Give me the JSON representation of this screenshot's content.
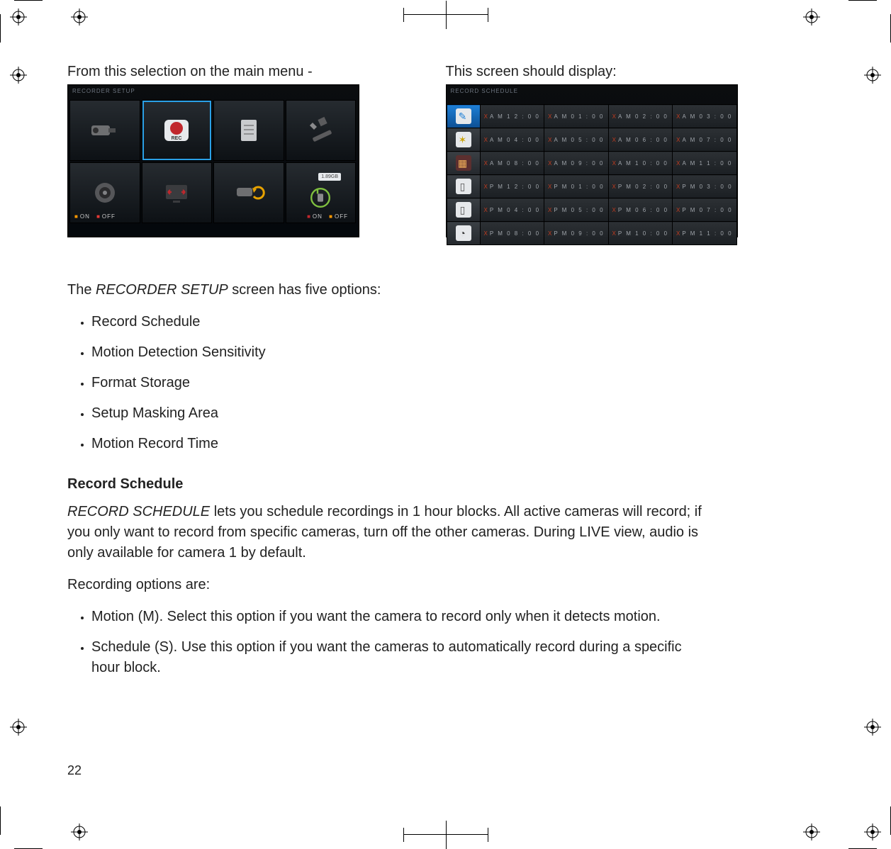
{
  "page_number": "22",
  "figures": {
    "left": {
      "caption": "From this selection on the main menu -",
      "screen_title": "RECORDER SETUP",
      "on_label": "ON",
      "off_label": "OFF",
      "sd_label": "1.89GB"
    },
    "right": {
      "caption": "This screen should display:",
      "screen_title": "RECORD SCHEDULE",
      "rows": [
        [
          "AM12:00",
          "AM01:00",
          "AM02:00",
          "AM03:00"
        ],
        [
          "AM04:00",
          "AM05:00",
          "AM06:00",
          "AM07:00"
        ],
        [
          "AM08:00",
          "AM09:00",
          "AM10:00",
          "AM11:00"
        ],
        [
          "PM12:00",
          "PM01:00",
          "PM02:00",
          "PM03:00"
        ],
        [
          "PM04:00",
          "PM05:00",
          "PM06:00",
          "PM07:00"
        ],
        [
          "PM08:00",
          "PM09:00",
          "PM10:00",
          "PM11:00"
        ]
      ]
    }
  },
  "body": {
    "intro_pre": "The ",
    "intro_em": "RECORDER SETUP",
    "intro_post": " screen has five options:",
    "options": [
      "Record Schedule",
      "Motion Detection Sensitivity",
      "Format Storage",
      "Setup Masking Area",
      " Motion Record Time"
    ],
    "heading": "Record Schedule",
    "para1_em": "RECORD SCHEDULE",
    "para1_rest": " lets you schedule recordings in 1 hour blocks. All active cameras will record; if you only want to record from specific cameras, turn off the other cameras. During LIVE view, audio is only available for camera 1 by default.",
    "para2": "Recording options are:",
    "options2": [
      "Motion (M). Select this option if you want the camera to record only when it detects motion.",
      "Schedule (S). Use this option if you want the cameras to automatically record during a specific hour block."
    ]
  }
}
